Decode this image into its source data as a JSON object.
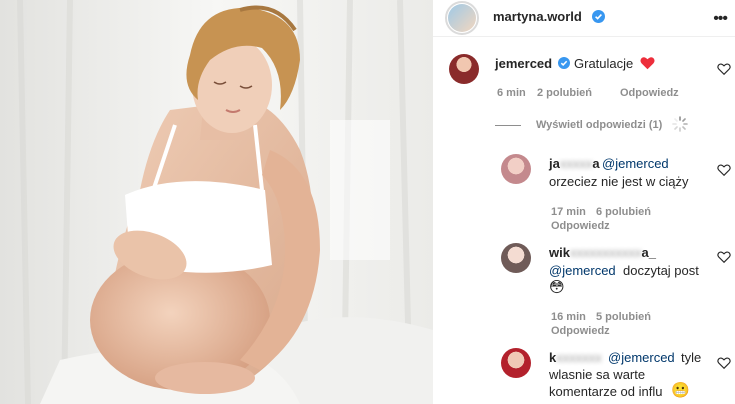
{
  "header": {
    "username": "martyna.world",
    "more_label": "•••"
  },
  "comments": [
    {
      "username": "jemerced",
      "text": "Gratulacje",
      "time": "6 min",
      "likes": "2 polubień",
      "reply": "Odpowiedz",
      "view_replies": "Wyświetl odpowiedzi (1)"
    }
  ],
  "replies": [
    {
      "username_start": "ja",
      "username_end": "a",
      "mention": "@jemerced",
      "line2": "orzeciez nie jest w ciąży",
      "time": "17 min",
      "likes": "6 polubień",
      "reply": "Odpowiedz"
    },
    {
      "username_start": "wik",
      "username_end": "a_",
      "mention": "@jemerced",
      "text": "doczytaj post",
      "emoji": "😳",
      "time": "16 min",
      "likes": "5 polubień",
      "reply": "Odpowiedz"
    },
    {
      "username_start": "k",
      "mention": "@jemerced",
      "text": "tyle",
      "line2": "wlasnie sa warte",
      "line3": "komentarze od influ",
      "emoji": "😬"
    }
  ],
  "colors": {
    "verified": "#3897f0",
    "heart": "#ed4956",
    "mention": "#00376b",
    "meta": "#8e8e8e"
  },
  "icons": [
    "verified-icon",
    "heart-emoji",
    "like-heart-icon",
    "loading-spinner-icon"
  ]
}
